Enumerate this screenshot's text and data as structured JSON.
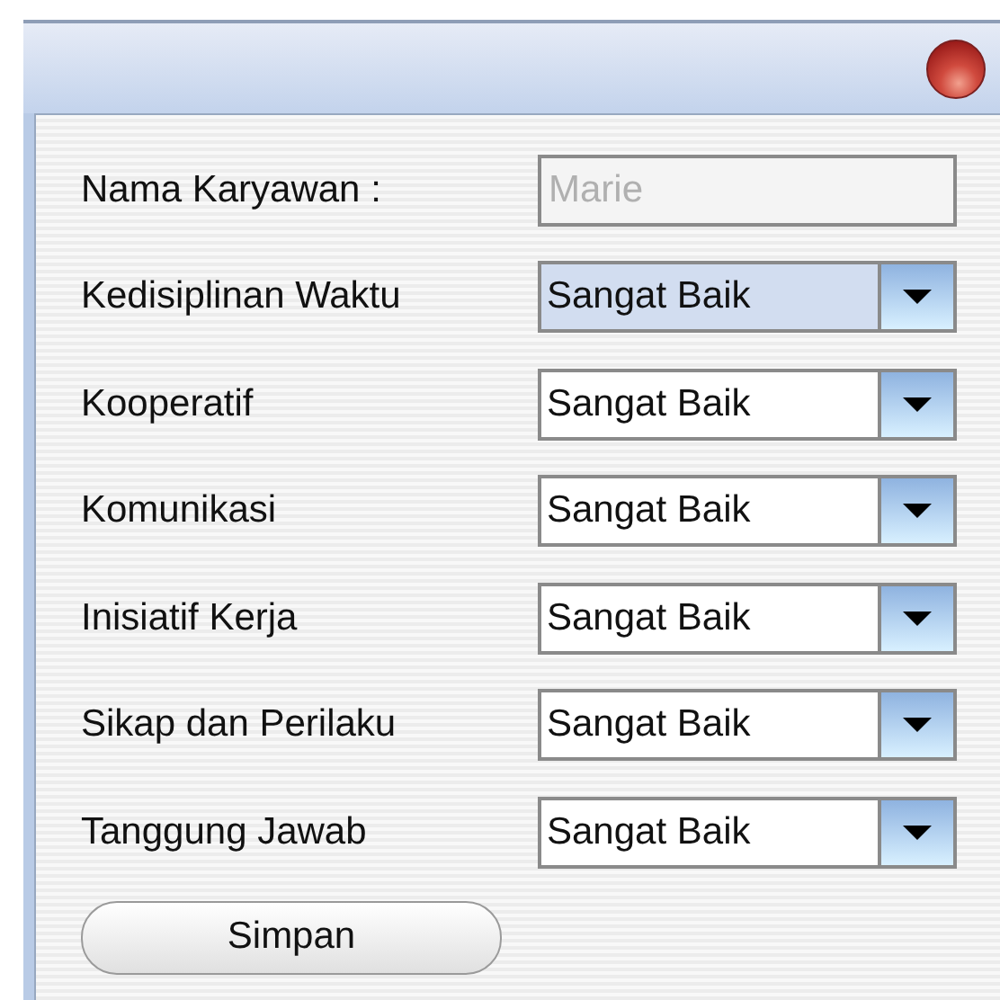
{
  "name_field": {
    "label": "Nama Karyawan :",
    "value": "Marie",
    "disabled": true
  },
  "ratings": [
    {
      "label": "Kedisiplinan Waktu",
      "value": "Sangat Baik",
      "focused": true
    },
    {
      "label": "Kooperatif",
      "value": "Sangat Baik",
      "focused": false
    },
    {
      "label": "Komunikasi",
      "value": "Sangat Baik",
      "focused": false
    },
    {
      "label": "Inisiatif Kerja",
      "value": "Sangat Baik",
      "focused": false
    },
    {
      "label": "Sikap dan Perilaku",
      "value": "Sangat Baik",
      "focused": false
    },
    {
      "label": "Tanggung Jawab",
      "value": "Sangat Baik",
      "focused": false
    }
  ],
  "save_button": "Simpan"
}
